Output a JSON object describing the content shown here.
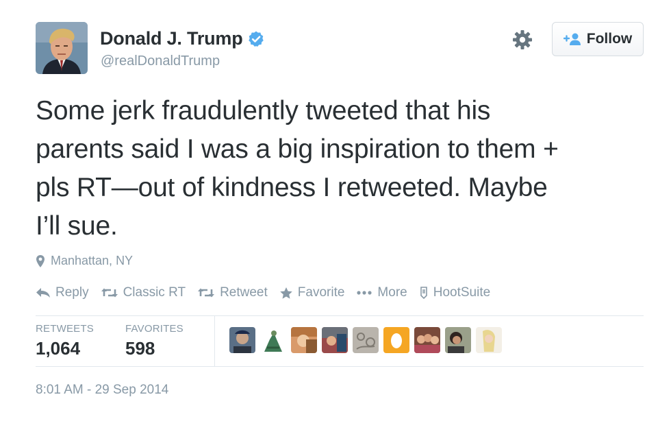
{
  "user": {
    "display_name": "Donald J. Trump",
    "handle": "@realDonaldTrump",
    "verified_icon": "verified-badge-icon",
    "follow_label": "Follow"
  },
  "tweet": {
    "line1": "Some jerk fraudulently tweeted that his",
    "line2": "parents said I was a big inspiration to them +",
    "line3": "pls RT—out of kindness I retweeted. Maybe",
    "line4": "I’ll sue.",
    "location": "Manhattan, NY",
    "timestamp": "8:01 AM - 29 Sep 2014"
  },
  "actions": {
    "reply": "Reply",
    "classic_rt": "Classic RT",
    "retweet": "Retweet",
    "favorite": "Favorite",
    "more": "More",
    "hootsuite": "HootSuite"
  },
  "stats": {
    "retweets_label": "RETWEETS",
    "retweets_value": "1,064",
    "favorites_label": "FAVORITES",
    "favorites_value": "598"
  },
  "colors": {
    "text": "#292f33",
    "muted": "#8899a6",
    "verified": "#55acee",
    "divider": "#e1e8ed"
  }
}
